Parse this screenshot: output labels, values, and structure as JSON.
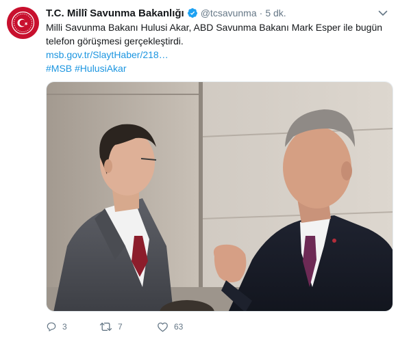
{
  "tweet": {
    "display_name": "T.C. Millî Savunma Bakanlığı",
    "handle": "@tcsavunma",
    "separator": "·",
    "time": "5 dk.",
    "text_line1": "Milli Savunma Bakanı Hulusi Akar, ABD Savunma Bakanı Mark Esper ile bugün",
    "text_line2": "telefon görüşmesi gerçekleştirdi.",
    "link": "msb.gov.tr/SlaytHaber/218…",
    "hashtag1": "#MSB",
    "hashtag2": "#HulusiAkar"
  },
  "actions": {
    "reply_count": "3",
    "retweet_count": "7",
    "like_count": "63"
  },
  "icons": {
    "avatar": "ministry-emblem-icon",
    "verified": "verified-badge-icon",
    "caret": "chevron-down-icon",
    "reply": "reply-icon",
    "retweet": "retweet-icon",
    "like": "heart-icon"
  },
  "colors": {
    "link": "#1b95e0",
    "secondary_text": "#657786",
    "verified": "#1da1f2",
    "avatar_bg": "#c8102e"
  }
}
